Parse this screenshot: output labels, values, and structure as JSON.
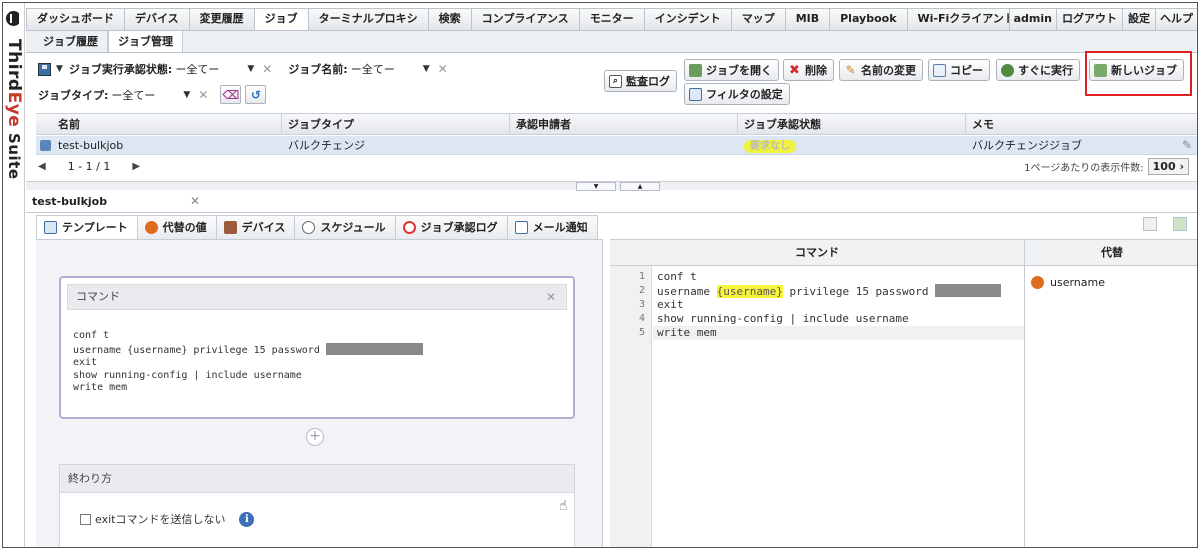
{
  "brand": {
    "third": "Third",
    "eye": "Eye",
    "suite": " Suite"
  },
  "topnav": {
    "tabs": [
      "ダッシュボード",
      "デバイス",
      "変更履歴",
      "ジョブ",
      "ターミナルプロキシ",
      "検索",
      "コンプライアンス",
      "モニター",
      "インシデント",
      "マップ",
      "MIB",
      "Playbook",
      "Wi-Fiクライアント"
    ],
    "active": "ジョブ",
    "right": [
      "admin",
      "ログアウト",
      "設定",
      "ヘルプ"
    ]
  },
  "subnav": {
    "tabs": [
      "ジョブ履歴",
      "ジョブ管理"
    ],
    "active": "ジョブ管理"
  },
  "filters": {
    "approval_label": "ジョブ実行承認状態:",
    "approval_value": "ー全てー",
    "name_label": "ジョブ名前:",
    "name_value": "ー全てー",
    "type_label": "ジョブタイプ:",
    "type_value": "ー全てー"
  },
  "toolbar": {
    "audit_log": "監査ログ",
    "open_job": "ジョブを開く",
    "delete": "削除",
    "rename": "名前の変更",
    "copy": "コピー",
    "run_now": "すぐに実行",
    "new_job": "新しいジョブ",
    "filter_settings": "フィルタの設定"
  },
  "grid": {
    "columns": [
      "名前",
      "ジョブタイプ",
      "承認申請者",
      "ジョブ承認状態",
      "メモ"
    ],
    "rows": [
      {
        "name": "test-bulkjob",
        "type": "バルクチェンジ",
        "requester": "",
        "status": "要求なし",
        "memo": "バルクチェンジジョブ"
      }
    ]
  },
  "pager": {
    "range": "1 - 1 / 1",
    "per_page_label": "1ページあたりの表示件数:",
    "per_page_value": "100"
  },
  "document": {
    "tab_title": "test-bulkjob"
  },
  "editor_tabs": [
    "テンプレート",
    "代替の値",
    "デバイス",
    "スケジュール",
    "ジョブ承認ログ",
    "メール通知"
  ],
  "template": {
    "command_title": "コマンド",
    "command_lines": [
      "conf t",
      "username {username} privilege 15 password",
      "exit",
      "show running-config | include username",
      "write mem"
    ],
    "ending_title": "終わり方",
    "ending_option": "exitコマンドを送信しない"
  },
  "code_pane": {
    "header": "コマンド",
    "line_numbers": [
      "1",
      "2",
      "3",
      "4",
      "5"
    ],
    "lines": [
      "conf t",
      "username ",
      "{username}",
      " privilege 15 password ",
      "exit",
      "show running-config | include username",
      "write mem"
    ]
  },
  "substitutions": {
    "header": "代替",
    "items": [
      "username"
    ]
  }
}
